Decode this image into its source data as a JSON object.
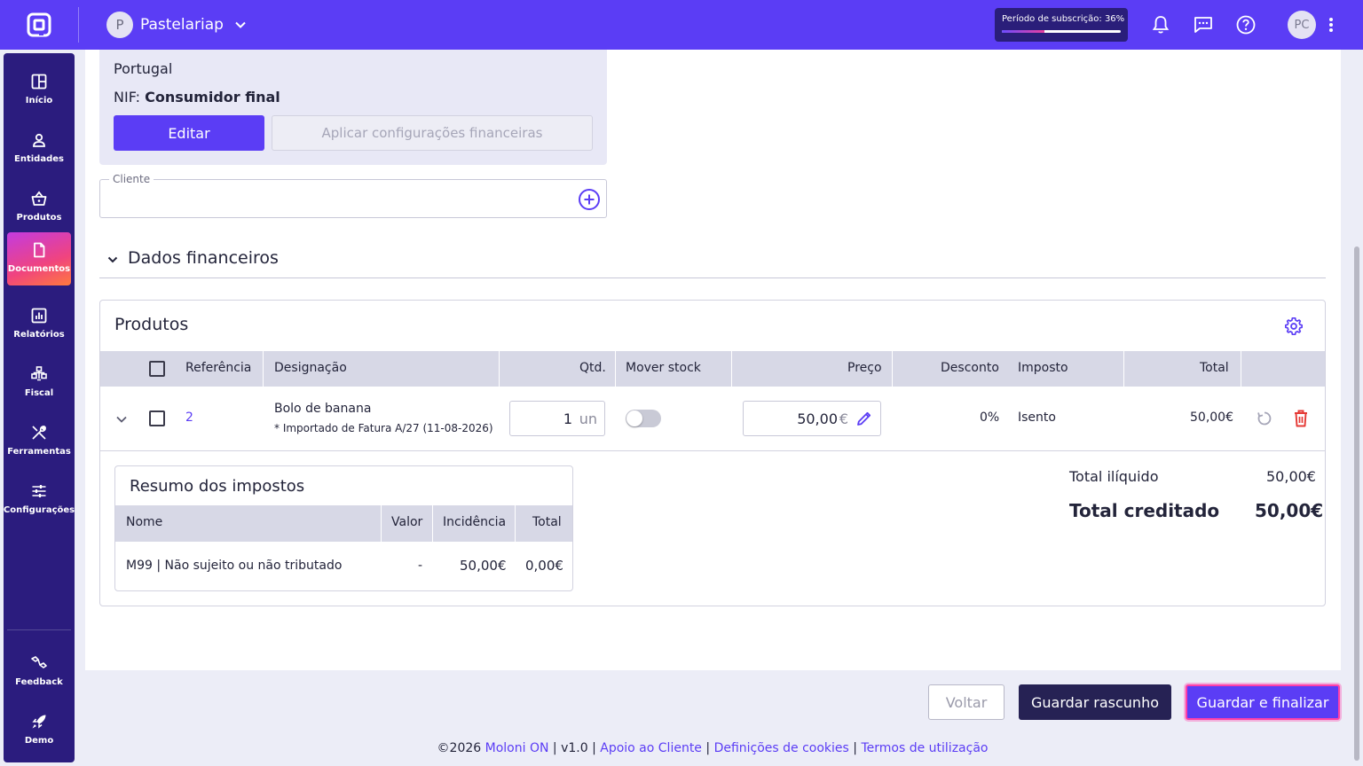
{
  "topbar": {
    "company_initial": "P",
    "company_name": "Pastelariap",
    "subscription_text": "Período de subscrição: 36%",
    "subscription_progress": 0.36,
    "user_initials": "PC"
  },
  "sidebar": {
    "items": [
      {
        "label": "Início",
        "icon": "grid-icon"
      },
      {
        "label": "Entidades",
        "icon": "person-icon"
      },
      {
        "label": "Produtos",
        "icon": "basket-icon"
      },
      {
        "label": "Documentos",
        "icon": "document-icon",
        "active": true
      },
      {
        "label": "Relatórios",
        "icon": "report-icon"
      },
      {
        "label": "Fiscal",
        "icon": "fiscal-icon"
      },
      {
        "label": "Ferramentas",
        "icon": "tools-icon"
      },
      {
        "label": "Configurações",
        "icon": "sliders-icon"
      }
    ],
    "bottom_items": [
      {
        "label": "Feedback",
        "icon": "feedback-icon"
      },
      {
        "label": "Demo",
        "icon": "rocket-icon"
      }
    ]
  },
  "client": {
    "country": "Portugal",
    "nif_label": "NIF:",
    "nif_value": "Consumidor final",
    "edit_label": "Editar",
    "apply_label": "Aplicar configurações financeiras",
    "cliente_label": "Cliente"
  },
  "financial": {
    "title": "Dados financeiros"
  },
  "products": {
    "title": "Produtos",
    "headers": {
      "reference": "Referência",
      "designation": "Designação",
      "qty": "Qtd.",
      "move_stock": "Mover stock",
      "price": "Preço",
      "discount": "Desconto",
      "tax": "Imposto",
      "total": "Total"
    },
    "rows": [
      {
        "reference": "2",
        "designation": "Bolo de banana",
        "note": "* Importado de Fatura A/27 (11-08-2026)",
        "qty": "1",
        "unit": "un",
        "move_stock": false,
        "price": "50,00",
        "currency": "€",
        "discount": "0%",
        "tax": "Isento",
        "total": "50,00€"
      }
    ]
  },
  "tax_summary": {
    "title": "Resumo dos impostos",
    "headers": {
      "name": "Nome",
      "value": "Valor",
      "incidence": "Incidência",
      "total": "Total"
    },
    "rows": [
      {
        "name": "M99 | Não sujeito ou não tributado",
        "value": "-",
        "incidence": "50,00€",
        "total": "0,00€"
      }
    ]
  },
  "totals": {
    "net_label": "Total ilíquido",
    "net_value": "50,00€",
    "credited_label": "Total creditado",
    "credited_value": "50,00€"
  },
  "actions": {
    "back": "Voltar",
    "draft": "Guardar rascunho",
    "finalize": "Guardar e finalizar"
  },
  "footer": {
    "copyright": "©2026",
    "brand": "Moloni ON",
    "version": "v1.0",
    "support": "Apoio ao Cliente",
    "cookies": "Definições de cookies",
    "terms": "Termos de utilização",
    "sep": "|"
  },
  "colors": {
    "primary": "#5B3DF5",
    "sidebar": "#2B1C7E",
    "danger": "#E53935"
  }
}
